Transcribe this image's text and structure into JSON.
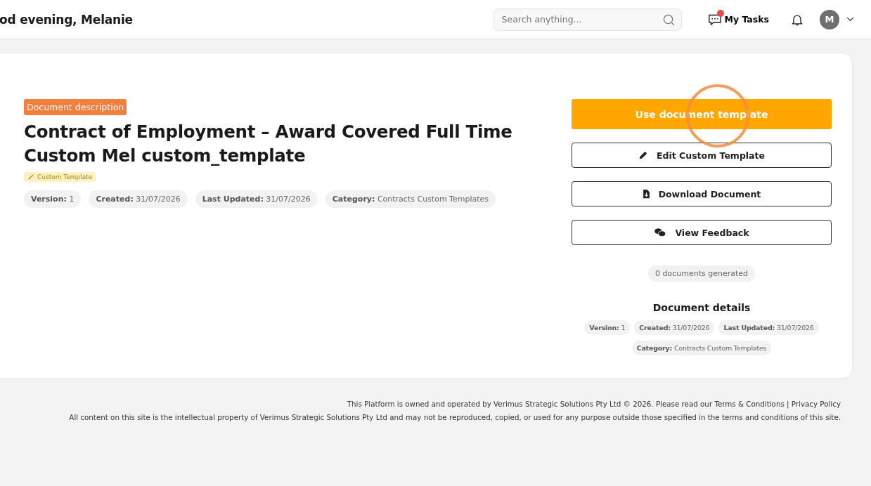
{
  "header": {
    "greeting": "od evening, Melanie",
    "search": {
      "placeholder": "Search anything..."
    },
    "tasks": {
      "label": "My Tasks",
      "unread": true
    },
    "avatar": {
      "initial": "M"
    }
  },
  "document": {
    "badge": "Document description",
    "title": "Contract of Employment – Award Covered Full Time Custom Mel custom_template",
    "tag": "Custom Template",
    "meta": [
      "**Version:** 1",
      "**Created:** 31/07/2026",
      "**Last Updated:** 31/07/2026",
      "**Category:** Contracts  Custom Templates"
    ]
  },
  "actions": {
    "primary": "Use document template",
    "buttons": [
      {
        "kind": "edit",
        "label": "Edit Custom Template"
      },
      {
        "kind": "download",
        "label": "Download Document"
      },
      {
        "kind": "feedback",
        "label": "View Feedback"
      }
    ],
    "count": "0 documents generated"
  },
  "details": {
    "title": "Document details",
    "meta": [
      "**Version:** 1",
      "**Created:** 31/07/2026",
      "**Last Updated:** 31/07/2026",
      "**Category:** Contracts Custom Templates"
    ]
  },
  "footer": {
    "notice": "This Platform is owned and operated by Verimus Strategic Solutions Pty Ltd © 2026. Please read our",
    "links": [
      "Terms & Conditions",
      "Privacy Policy"
    ],
    "separator": "|",
    "copyright": "All content on this site is the intellectual property of Verimus Strategic Solutions Pty Ltd and may not be reproduced, copied, or used for any purpose outside those specified in the terms and conditions of this site."
  }
}
